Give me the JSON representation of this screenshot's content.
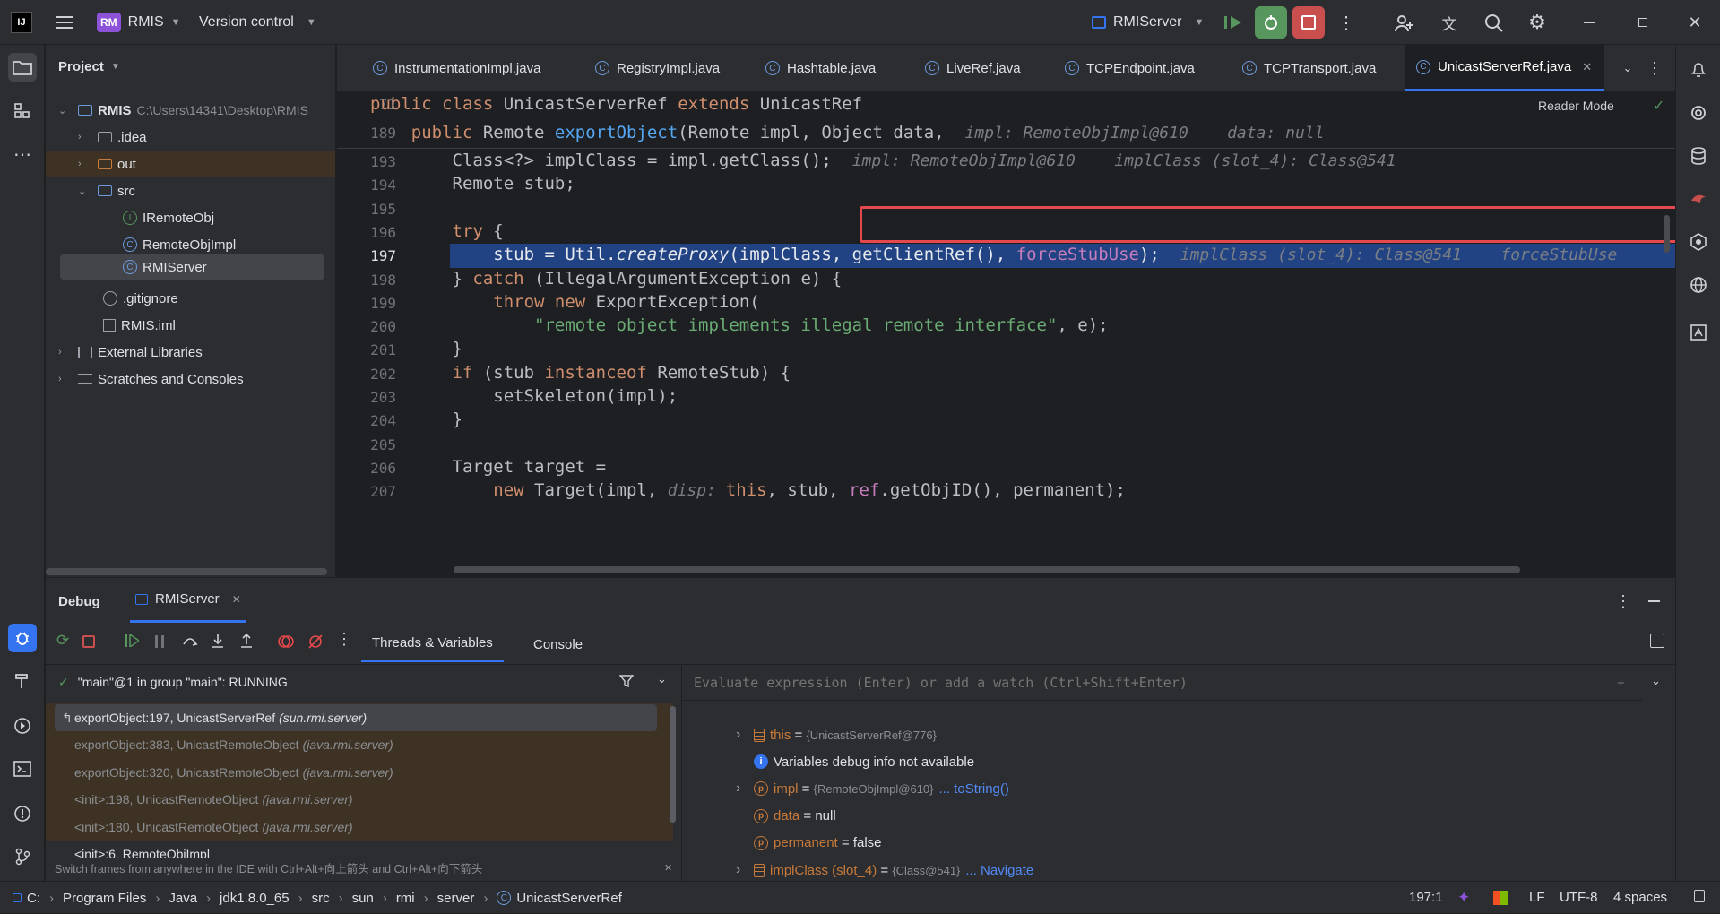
{
  "titlebar": {
    "project_badge": "RM",
    "project_name": "RMIS",
    "vcs": "Version control",
    "run_config": "RMIServer"
  },
  "project_panel": {
    "title": "Project",
    "root_name": "RMIS",
    "root_path": "C:\\Users\\14341\\Desktop\\RMIS",
    "items": [
      ".idea",
      "out",
      "src",
      "IRemoteObj",
      "RemoteObjImpl",
      "RMIServer",
      ".gitignore",
      "RMIS.iml",
      "External Libraries",
      "Scratches and Consoles"
    ]
  },
  "tabs": [
    "InstrumentationImpl.java",
    "RegistryImpl.java",
    "Hashtable.java",
    "LiveRef.java",
    "TCPEndpoint.java",
    "TCPTransport.java",
    "UnicastServerRef.java"
  ],
  "editor": {
    "reader_mode": "Reader Mode",
    "sticky": [
      {
        "ln": "71",
        "parts": [
          [
            "kw",
            "public class "
          ],
          [
            "t",
            "UnicastServerRef "
          ],
          [
            "kw",
            "extends "
          ],
          [
            "t",
            "UnicastRef"
          ]
        ]
      },
      {
        "ln": "189",
        "parts": [
          [
            "kw",
            "    public "
          ],
          [
            "t",
            "Remote "
          ],
          [
            "fn",
            "exportObject"
          ],
          [
            "t",
            "(Remote impl, Object data,  "
          ],
          [
            "hint",
            "impl: RemoteObjImpl@610    data: null"
          ]
        ]
      }
    ],
    "lines": [
      {
        "ln": "193",
        "parts": [
          [
            "t",
            "        Class<?> implClass = impl.getClass();  "
          ],
          [
            "hint",
            "impl: RemoteObjImpl@610    implClass (slot_4): Class@541"
          ]
        ]
      },
      {
        "ln": "194",
        "parts": [
          [
            "t",
            "        Remote stub;"
          ]
        ]
      },
      {
        "ln": "195",
        "parts": [
          [
            "t",
            ""
          ]
        ]
      },
      {
        "ln": "196",
        "parts": [
          [
            "kw",
            "        try "
          ],
          [
            "t",
            "{"
          ]
        ]
      },
      {
        "ln": "197",
        "current": true,
        "parts": [
          [
            "t",
            "            stub = Util."
          ],
          [
            "it",
            "createProxy"
          ],
          [
            "t",
            "(implClass, getClientRef(), "
          ],
          [
            "pu",
            "forceStubUse"
          ],
          [
            "t",
            ");  "
          ],
          [
            "hint",
            "implClass (slot_4): Class@541    forceStubUse"
          ]
        ]
      },
      {
        "ln": "198",
        "parts": [
          [
            "t",
            "        } "
          ],
          [
            "kw",
            "catch "
          ],
          [
            "t",
            "(IllegalArgumentException e) {"
          ]
        ]
      },
      {
        "ln": "199",
        "parts": [
          [
            "kw",
            "            throw new "
          ],
          [
            "t",
            "ExportException("
          ]
        ]
      },
      {
        "ln": "200",
        "parts": [
          [
            "st",
            "                \"remote object implements illegal remote interface\""
          ],
          [
            "t",
            ", e);"
          ]
        ]
      },
      {
        "ln": "201",
        "parts": [
          [
            "t",
            "        }"
          ]
        ]
      },
      {
        "ln": "202",
        "parts": [
          [
            "kw",
            "        if "
          ],
          [
            "t",
            "(stub "
          ],
          [
            "kw",
            "instanceof "
          ],
          [
            "t",
            "RemoteStub) {"
          ]
        ]
      },
      {
        "ln": "203",
        "parts": [
          [
            "t",
            "            setSkeleton(impl);"
          ]
        ]
      },
      {
        "ln": "204",
        "parts": [
          [
            "t",
            "        }"
          ]
        ]
      },
      {
        "ln": "205",
        "parts": [
          [
            "t",
            ""
          ]
        ]
      },
      {
        "ln": "206",
        "parts": [
          [
            "t",
            "        Target target ="
          ]
        ]
      },
      {
        "ln": "207",
        "parts": [
          [
            "kw",
            "            new "
          ],
          [
            "t",
            "Target(impl, "
          ],
          [
            "hint",
            "disp: "
          ],
          [
            "kw",
            "this"
          ],
          [
            "t",
            ", stub, "
          ],
          [
            "pu",
            "ref"
          ],
          [
            "t",
            ".getObjID(), permanent);"
          ]
        ]
      }
    ]
  },
  "debug": {
    "title": "Debug",
    "session": "RMIServer",
    "tab_threads": "Threads & Variables",
    "tab_console": "Console",
    "thread": "\"main\"@1 in group \"main\": RUNNING",
    "frames": [
      {
        "m": "exportObject:197, UnicastServerRef",
        "p": "(sun.rmi.server)"
      },
      {
        "m": "exportObject:383, UnicastRemoteObject",
        "p": "(java.rmi.server)"
      },
      {
        "m": "exportObject:320, UnicastRemoteObject",
        "p": "(java.rmi.server)"
      },
      {
        "m": "<init>:198, UnicastRemoteObject",
        "p": "(java.rmi.server)"
      },
      {
        "m": "<init>:180, UnicastRemoteObject",
        "p": "(java.rmi.server)"
      },
      {
        "m": "<init>:6, RemoteObjImpl",
        "p": ""
      }
    ],
    "hint": "Switch frames from anywhere in the IDE with Ctrl+Alt+向上箭头 and Ctrl+Alt+向下箭头",
    "eval_placeholder": "Evaluate expression (Enter) or add a watch (Ctrl+Shift+Enter)",
    "vars": [
      {
        "name": "this",
        "eq": " = ",
        "val": "{UnicastServerRef@776}",
        "link": ""
      },
      {
        "name": "Variables debug info not available",
        "eq": "",
        "val": "",
        "link": ""
      },
      {
        "name": "impl",
        "eq": " = ",
        "val": "{RemoteObjImpl@610}",
        "link": "... toString()"
      },
      {
        "name": "data",
        "eq": " = ",
        "val": "null",
        "link": ""
      },
      {
        "name": "permanent",
        "eq": " = ",
        "val": "false",
        "link": ""
      },
      {
        "name": "implClass (slot_4)",
        "eq": " = ",
        "val": "{Class@541}",
        "link": "... Navigate"
      }
    ]
  },
  "statusbar": {
    "crumbs": [
      "C:",
      "Program Files",
      "Java",
      "jdk1.8.0_65",
      "src",
      "sun",
      "rmi",
      "server",
      "UnicastServerRef"
    ],
    "position": "197:1",
    "line_sep": "LF",
    "encoding": "UTF-8",
    "indent": "4 spaces"
  },
  "colors": {
    "accent": "#3574f0",
    "selection": "#214283",
    "highlight_box": "#e5484d",
    "run_green": "#57965c",
    "stop_red": "#c94f4f"
  }
}
